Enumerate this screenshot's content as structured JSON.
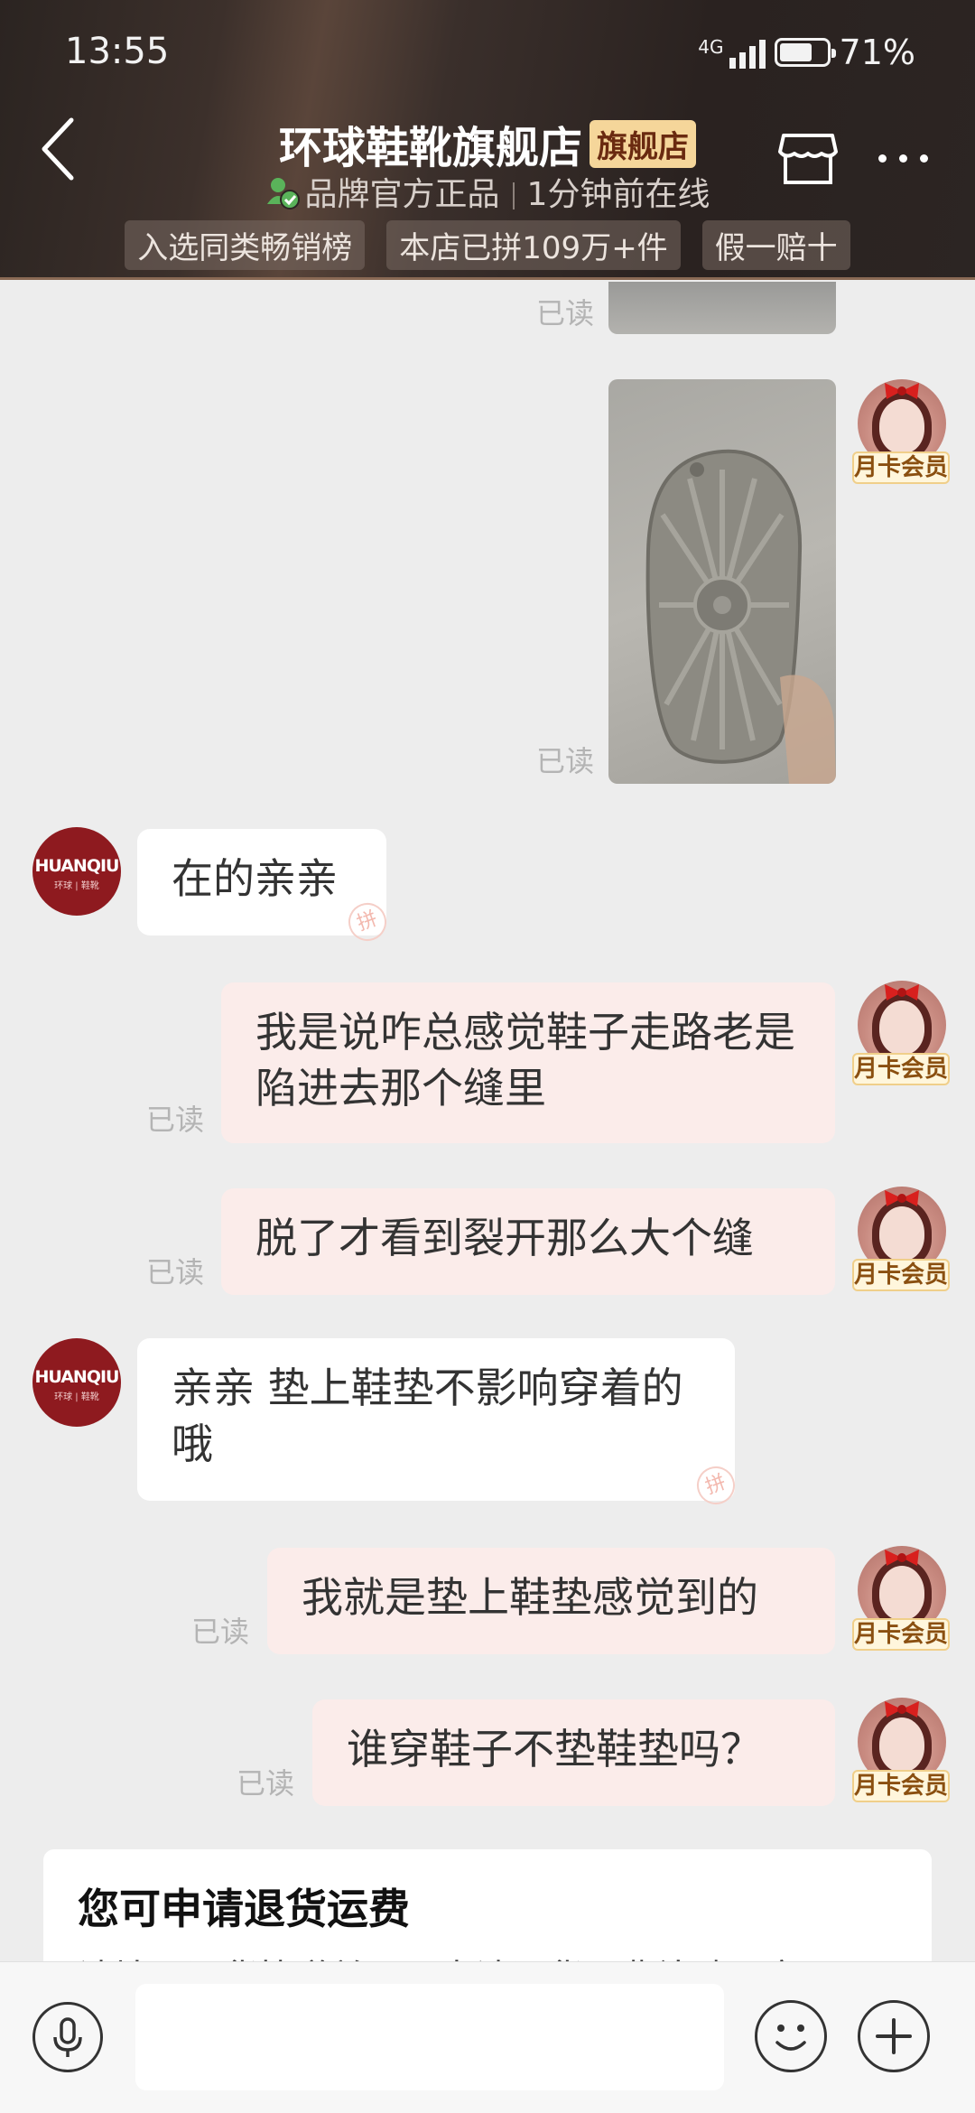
{
  "status_bar": {
    "time": "13:55",
    "network": "4G",
    "battery": "71%",
    "battery_level": 0.71
  },
  "header": {
    "shop_name": "环球鞋靴旗舰店",
    "flagship_badge": "旗舰店",
    "authentic_label": "品牌官方正品",
    "online_status": "1分钟前在线",
    "tags": [
      "入选同类畅销榜",
      "本店已拼109万+件",
      "假一赔十"
    ]
  },
  "shop_avatar": {
    "logo_text": "HUANQIU",
    "sub_text": "环球 | 鞋靴"
  },
  "member_badge": "月卡会员",
  "bubble_stamp": "拼",
  "messages": [
    {
      "from": "me",
      "type": "image",
      "read": "已读"
    },
    {
      "from": "me",
      "type": "image",
      "read": "已读"
    },
    {
      "from": "shop",
      "text": "在的亲亲"
    },
    {
      "from": "me",
      "text": "我是说咋总感觉鞋子走路老是陷进去那个缝里",
      "read": "已读"
    },
    {
      "from": "me",
      "text": "脱了才看到裂开那么大个缝",
      "read": "已读"
    },
    {
      "from": "shop",
      "text": "亲亲  垫上鞋垫不影响穿着的哦"
    },
    {
      "from": "me",
      "text": "我就是垫上鞋垫感觉到的",
      "read": "已读"
    },
    {
      "from": "me",
      "text": "谁穿鞋子不垫鞋垫吗？",
      "read": "已读"
    }
  ],
  "refund_card": {
    "title": "您可申请退货运费",
    "desc": "请填写退货快递单号，申请退货运费补贴，官"
  },
  "input_bar": {
    "placeholder": ""
  },
  "icons": [
    "back-arrow-icon",
    "verified-user-icon",
    "store-icon",
    "more-icon",
    "microphone-icon",
    "emoji-icon",
    "plus-icon"
  ]
}
